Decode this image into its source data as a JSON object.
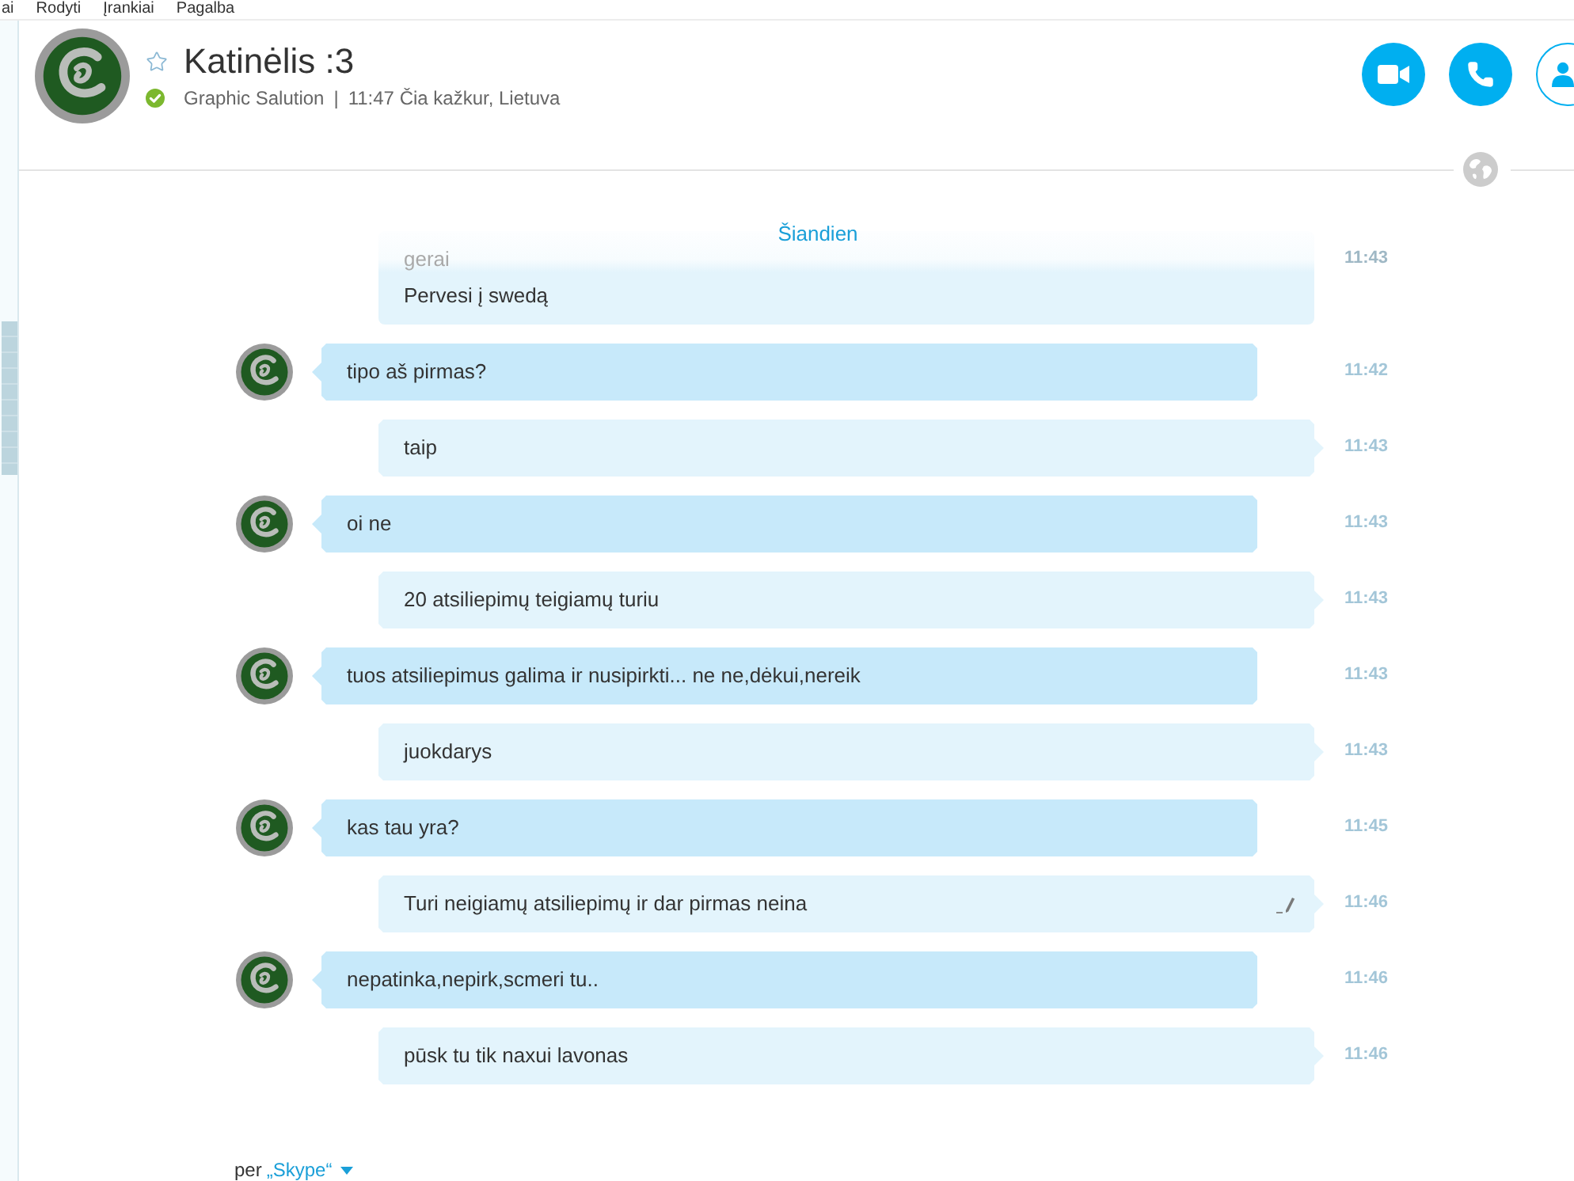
{
  "menu_bar": {
    "items": [
      "ai",
      "Rodyti",
      "Įrankiai",
      "Pagalba"
    ]
  },
  "contact": {
    "name": "Katinėlis :3",
    "favorite": false,
    "online": true,
    "mood": "Graphic Salution",
    "separator": "|",
    "local_info": "11:47 Čia kažkur, Lietuva"
  },
  "call_buttons": [
    {
      "kind": "video"
    },
    {
      "kind": "audio"
    },
    {
      "kind": "add_people"
    }
  ],
  "date_divider": "Šiandien",
  "messages": [
    {
      "kind": "outgoing",
      "lines": [
        {
          "text": "gerai",
          "time": "11:43",
          "faded": true,
          "edited": false
        },
        {
          "text": "Pervesi į swedą",
          "faded": false,
          "edited": false
        }
      ]
    },
    {
      "kind": "incoming",
      "lines": [
        {
          "text": "tipo aš pirmas?",
          "time": "11:42",
          "faded": false,
          "edited": false
        }
      ]
    },
    {
      "kind": "outgoing",
      "lines": [
        {
          "text": "taip",
          "time": "11:43",
          "faded": false,
          "edited": false
        }
      ]
    },
    {
      "kind": "incoming",
      "lines": [
        {
          "text": "oi ne",
          "time": "11:43",
          "faded": false,
          "edited": false
        }
      ]
    },
    {
      "kind": "outgoing",
      "lines": [
        {
          "text": "20 atsiliepimų teigiamų turiu",
          "time": "11:43",
          "faded": false,
          "edited": false
        }
      ]
    },
    {
      "kind": "incoming",
      "lines": [
        {
          "text": "tuos atsiliepimus galima ir nusipirkti... ne ne,dėkui,nereik",
          "time": "11:43",
          "faded": false,
          "edited": false
        }
      ]
    },
    {
      "kind": "outgoing",
      "lines": [
        {
          "text": "juokdarys",
          "time": "11:43",
          "faded": false,
          "edited": false
        }
      ]
    },
    {
      "kind": "incoming",
      "lines": [
        {
          "text": "kas tau yra?",
          "time": "11:45",
          "faded": false,
          "edited": false
        }
      ]
    },
    {
      "kind": "outgoing",
      "lines": [
        {
          "text": "Turi neigiamų atsiliepimų ir dar pirmas neina",
          "time": "11:46",
          "faded": false,
          "edited": true
        }
      ]
    },
    {
      "kind": "incoming",
      "lines": [
        {
          "text": "nepatinka,nepirk,scmeri tu..",
          "time": "11:46",
          "faded": false,
          "edited": false
        }
      ]
    },
    {
      "kind": "outgoing",
      "lines": [
        {
          "text": "pūsk tu tik naxui lavonas",
          "time": "11:46",
          "faded": false,
          "edited": false
        }
      ]
    }
  ],
  "footer": {
    "prefix": "per",
    "service": "„Skype“"
  }
}
